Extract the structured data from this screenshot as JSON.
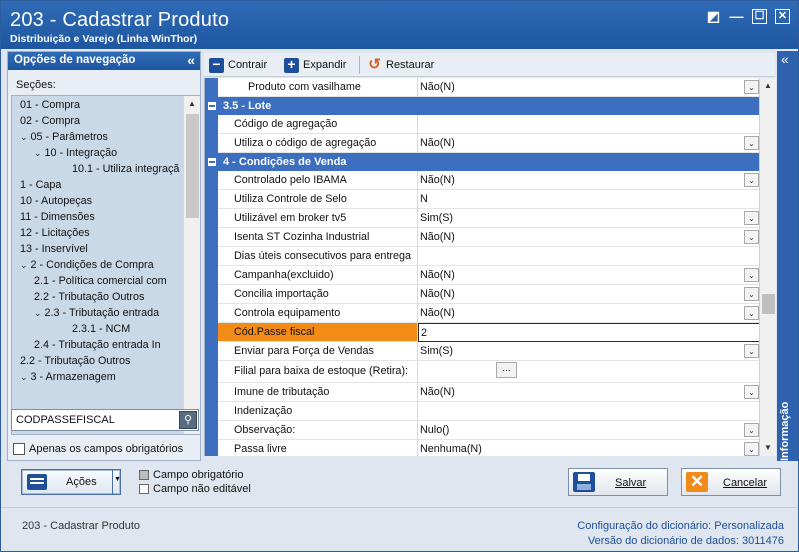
{
  "window": {
    "title": "203 - Cadastrar  Produto",
    "subtitle": "Distribuição e Varejo (Linha WinThor)",
    "controls": [
      "◩",
      "—",
      "☐",
      "✕"
    ]
  },
  "nav": {
    "header": "Opções de navegação",
    "collapse_glyph": "«",
    "sections_label": "Seções:",
    "tree": [
      {
        "text": "01 - Compra",
        "level": 0,
        "expander": ""
      },
      {
        "text": "02 - Compra",
        "level": 0,
        "expander": ""
      },
      {
        "text": "05 - Parâmetros",
        "level": 0,
        "expander": "v"
      },
      {
        "text": "10 - Integração",
        "level": 1,
        "expander": "v"
      },
      {
        "text": "10.1 - Utiliza integraçã",
        "level": 2,
        "expander": ""
      },
      {
        "text": "1 - Capa",
        "level": 0,
        "expander": ""
      },
      {
        "text": "10 - Autopeças",
        "level": 0,
        "expander": ""
      },
      {
        "text": "11 - Dimensões",
        "level": 0,
        "expander": ""
      },
      {
        "text": "12 - Licitações",
        "level": 0,
        "expander": ""
      },
      {
        "text": "13 - Inservível",
        "level": 0,
        "expander": ""
      },
      {
        "text": "2 - Condições de Compra",
        "level": 0,
        "expander": "v"
      },
      {
        "text": "2.1 - Política comercial com",
        "level": 1,
        "expander": ""
      },
      {
        "text": "2.2 - Tributação Outros",
        "level": 1,
        "expander": ""
      },
      {
        "text": "2.3 - Tributação entrada",
        "level": 1,
        "expander": "v"
      },
      {
        "text": "2.3.1 - NCM",
        "level": 2,
        "expander": ""
      },
      {
        "text": "2.4 - Tributação entrada In",
        "level": 1,
        "expander": ""
      },
      {
        "text": "2.2 - Tributação Outros",
        "level": 0,
        "expander": ""
      },
      {
        "text": "3 - Armazenagem",
        "level": 0,
        "expander": "v"
      }
    ],
    "search_value": "CODPASSEFISCAL",
    "required_only_label": "Apenas os campos obrigatórios"
  },
  "toolbar": {
    "collapse": "Contrair",
    "expand": "Expandir",
    "restore": "Restaurar"
  },
  "grid": [
    {
      "kind": "row",
      "label": "Produto com vasilhame",
      "value": "Não(N)",
      "dropdown": true,
      "indent": true
    },
    {
      "kind": "cat",
      "label": "3.5 - Lote"
    },
    {
      "kind": "row",
      "label": "Código de agregação",
      "value": "",
      "dropdown": false
    },
    {
      "kind": "row",
      "label": "Utiliza o código de agregação",
      "value": "Não(N)",
      "dropdown": true
    },
    {
      "kind": "cat",
      "label": "4 - Condições de Venda"
    },
    {
      "kind": "row",
      "label": "Controlado pelo IBAMA",
      "value": "Não(N)",
      "dropdown": true
    },
    {
      "kind": "row",
      "label": "Utiliza Controle de Selo",
      "value": "N",
      "dropdown": false
    },
    {
      "kind": "row",
      "label": "Utilizável em broker tv5",
      "value": "Sim(S)",
      "dropdown": true
    },
    {
      "kind": "row",
      "label": "Isenta ST Cozinha Industrial",
      "value": "Não(N)",
      "dropdown": true
    },
    {
      "kind": "row",
      "label": "Dias úteis consecutivos para entrega",
      "value": "",
      "dropdown": false
    },
    {
      "kind": "row",
      "label": "Campanha(excluido)",
      "value": "Não(N)",
      "dropdown": true
    },
    {
      "kind": "row",
      "label": "Concilia importação",
      "value": "Não(N)",
      "dropdown": true
    },
    {
      "kind": "row",
      "label": "Controla equipamento",
      "value": "Não(N)",
      "dropdown": true
    },
    {
      "kind": "row",
      "label": "Cód.Passe fiscal",
      "value": "2",
      "dropdown": false,
      "highlight": true
    },
    {
      "kind": "row",
      "label": "Enviar para Força de Vendas",
      "value": "Sim(S)",
      "dropdown": true
    },
    {
      "kind": "row",
      "label": "Filial para baixa de estoque (Retira):",
      "value": "",
      "dropdown": false,
      "ellipsis": "...",
      "tall": true
    },
    {
      "kind": "row",
      "label": "Imune de tributação",
      "value": "Não(N)",
      "dropdown": true
    },
    {
      "kind": "row",
      "label": "Indenização",
      "value": "",
      "dropdown": false
    },
    {
      "kind": "row",
      "label": "Observação:",
      "value": "Nulo()",
      "dropdown": true
    },
    {
      "kind": "row",
      "label": "Passa livre",
      "value": "Nenhuma(N)",
      "dropdown": true
    }
  ],
  "info_pane": {
    "label": "Informação",
    "collapse_glyph": "«"
  },
  "actions": {
    "label": "Ações"
  },
  "legend": {
    "required": "Campo obrigatório",
    "not_editable": "Campo não editável"
  },
  "buttons": {
    "save": "Salvar",
    "cancel": "Cancelar"
  },
  "footer": {
    "app": "203 - Cadastrar  Produto",
    "dict_config_label": "Configuração do dicionário:",
    "dict_config_value": "Personalizada",
    "dict_version_label": "Versão do dicionário de dados:",
    "dict_version_value": "3011476"
  },
  "colors": {
    "accent": "#2f6bb7",
    "category": "#3d6fc0",
    "highlight": "#f28c16"
  }
}
